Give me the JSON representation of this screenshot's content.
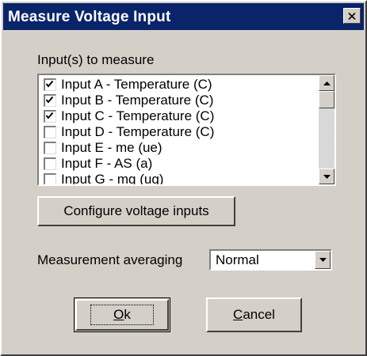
{
  "dialog": {
    "title": "Measure Voltage Input"
  },
  "inputs": {
    "label": "Input(s) to measure",
    "items": [
      {
        "label": "Input A - Temperature (C)",
        "checked": true
      },
      {
        "label": "Input B - Temperature (C)",
        "checked": true
      },
      {
        "label": "Input C - Temperature (C)",
        "checked": true
      },
      {
        "label": "Input D - Temperature (C)",
        "checked": false
      },
      {
        "label": "Input E - me (ue)",
        "checked": false
      },
      {
        "label": "Input F - AS (a)",
        "checked": false
      },
      {
        "label": "Input G - mg (ug)",
        "checked": false
      }
    ]
  },
  "configure_button": {
    "label": "Configure voltage inputs"
  },
  "averaging": {
    "label": "Measurement averaging",
    "value": "Normal"
  },
  "ok_button": {
    "label": "Ok",
    "accelerator": "O"
  },
  "cancel_button": {
    "label": "Cancel",
    "accelerator": "C"
  },
  "icons": {
    "close": "close-icon",
    "scroll_up": "arrow-up-icon",
    "scroll_down": "arrow-down-icon",
    "dropdown": "chevron-down-icon"
  },
  "colors": {
    "title_bar": "#0a246a",
    "face": "#d4d0c8"
  }
}
